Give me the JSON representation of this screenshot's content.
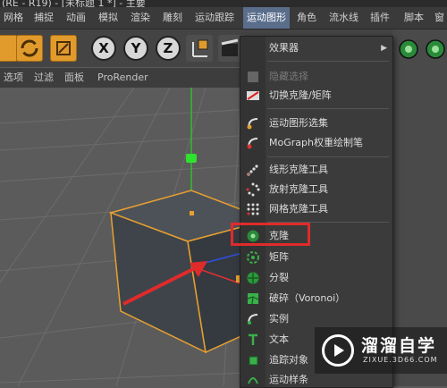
{
  "window": {
    "title": "(RE - R19) - [未标题 1 *] - 主要"
  },
  "menubar": {
    "items": [
      "网格",
      "捕捉",
      "动画",
      "模拟",
      "渲染",
      "雕刻",
      "运动跟踪",
      "运动图形",
      "角色",
      "流水线",
      "插件",
      "脚本",
      "窗"
    ],
    "active": "运动图形"
  },
  "toolbar": {
    "axes": [
      "X",
      "Y",
      "Z"
    ]
  },
  "subbar": {
    "items": [
      "选项",
      "过滤",
      "面板",
      "ProRender"
    ]
  },
  "dropdown": {
    "header": "效果器",
    "items": [
      {
        "label": "隐藏选择",
        "disabled": true,
        "icon": "hide-selection-icon"
      },
      {
        "label": "切换克隆/矩阵",
        "disabled": false,
        "icon": "toggle-clone-matrix-icon"
      },
      {
        "label": "运动图形选集",
        "disabled": false,
        "icon": "mograph-selection-icon"
      },
      {
        "label": "MoGraph权重绘制笔",
        "disabled": false,
        "icon": "mograph-weight-brush-icon"
      },
      {
        "label": "线形克隆工具",
        "disabled": false,
        "icon": "linear-clone-tool-icon"
      },
      {
        "label": "放射克隆工具",
        "disabled": false,
        "icon": "radial-clone-tool-icon"
      },
      {
        "label": "网格克隆工具",
        "disabled": false,
        "icon": "grid-clone-tool-icon"
      },
      {
        "label": "克隆",
        "disabled": false,
        "icon": "cloner-icon"
      },
      {
        "label": "矩阵",
        "disabled": false,
        "icon": "matrix-icon"
      },
      {
        "label": "分裂",
        "disabled": false,
        "icon": "fracture-icon"
      },
      {
        "label": "破碎（Voronoi）",
        "disabled": false,
        "icon": "voronoi-fracture-icon"
      },
      {
        "label": "实例",
        "disabled": false,
        "icon": "instance-icon"
      },
      {
        "label": "文本",
        "disabled": false,
        "icon": "text-icon"
      },
      {
        "label": "追踪对象",
        "disabled": false,
        "icon": "tracer-icon"
      },
      {
        "label": "运动样条",
        "disabled": false,
        "icon": "mospline-icon"
      }
    ]
  },
  "watermark": {
    "title": "溜溜自学",
    "url": "ZIXUE.3D66.COM"
  },
  "colors": {
    "accent_orange": "#e19b2d",
    "highlight_red": "#e02b2b",
    "menu_active": "#5a6e8c",
    "cube_edge": "#e8a030"
  }
}
